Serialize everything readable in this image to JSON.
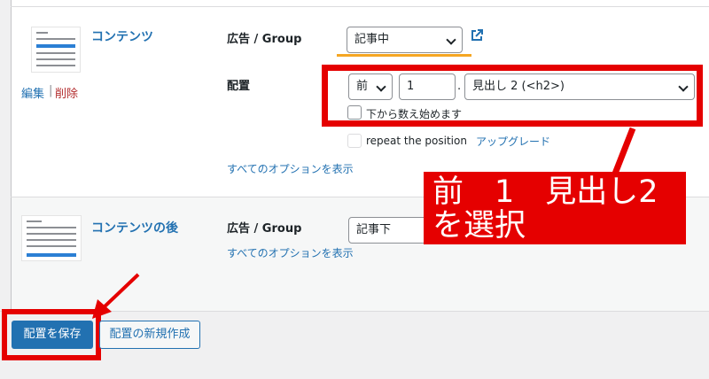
{
  "placements": [
    {
      "name": "コンテンツ",
      "edit_label": "編集",
      "separator": "|",
      "delete_label": "削除",
      "ad_group_label": "広告 / Group",
      "ad_group_value": "記事中",
      "position_label": "配置",
      "position_value": "前",
      "index_value": "1",
      "dot": ".",
      "heading_value": "見出し 2 (<h2>)",
      "count_from_bottom_label": "下から数え始めます",
      "repeat_label": "repeat the position",
      "upgrade_link": "アップグレード",
      "show_all_options": "すべてのオプションを表示"
    },
    {
      "name": "コンテンツの後",
      "ad_group_label": "広告 / Group",
      "ad_group_value": "記事下",
      "show_all_options": "すべてのオプションを表示"
    }
  ],
  "annotation": {
    "line1": "前　1　見出し2",
    "line2": "を選択"
  },
  "footer": {
    "save_button": "配置を保存",
    "new_button": "配置の新規作成"
  },
  "colors": {
    "primary": "#2271b1",
    "annotation_red": "#e50000",
    "underline_orange": "#f5a623",
    "delete_red": "#b32d2e"
  }
}
